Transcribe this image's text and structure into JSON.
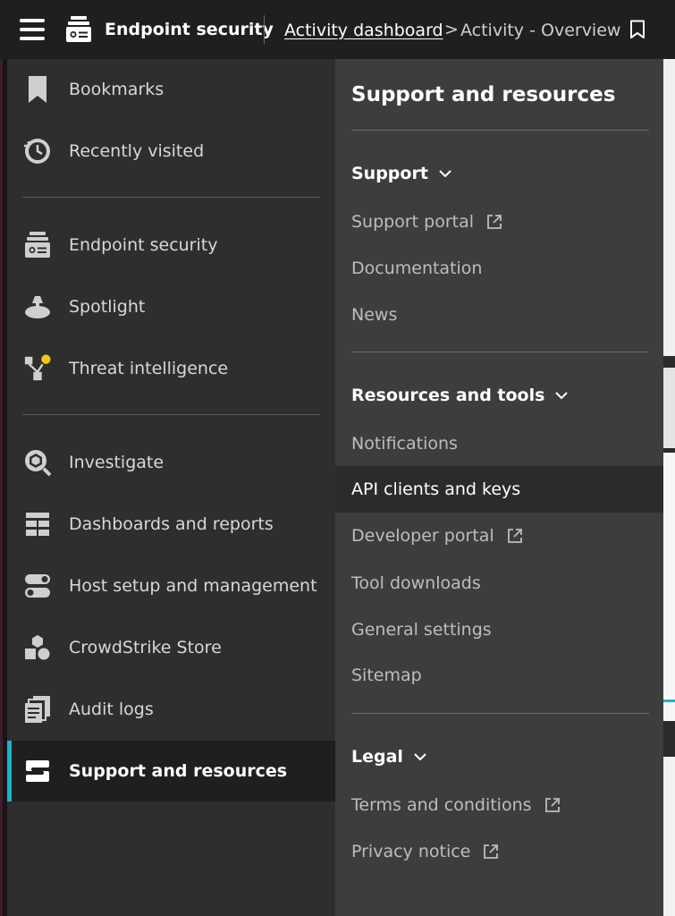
{
  "topbar": {
    "app_name": "Endpoint security",
    "breadcrumb_link": "Activity dashboard",
    "breadcrumb_sep": ">",
    "breadcrumb_current": "Activity - Overview",
    "icons": {
      "menu": "hamburger-icon",
      "app": "endpoint-security-icon",
      "bookmark": "bookmark-icon"
    }
  },
  "sidebar": {
    "items": [
      {
        "label": "Bookmarks",
        "icon": "bookmark-icon"
      },
      {
        "label": "Recently visited",
        "icon": "history-icon"
      },
      {
        "label": "Endpoint security",
        "icon": "endpoint-security-icon"
      },
      {
        "label": "Spotlight",
        "icon": "spotlight-icon"
      },
      {
        "label": "Threat intelligence",
        "icon": "threat-intelligence-icon"
      },
      {
        "label": "Investigate",
        "icon": "investigate-icon"
      },
      {
        "label": "Dashboards and reports",
        "icon": "dashboards-icon"
      },
      {
        "label": "Host setup and management",
        "icon": "host-setup-icon"
      },
      {
        "label": "CrowdStrike Store",
        "icon": "store-icon"
      },
      {
        "label": "Audit logs",
        "icon": "audit-logs-icon"
      },
      {
        "label": "Support and resources",
        "icon": "support-resources-icon"
      }
    ],
    "active_item": "Support and resources",
    "accent_color": "#19b3c9",
    "notification_dot_color": "#f5c518"
  },
  "panel": {
    "title": "Support and resources",
    "sections": [
      {
        "heading": "Support",
        "links": [
          {
            "label": "Support portal",
            "external": true
          },
          {
            "label": "Documentation",
            "external": false
          },
          {
            "label": "News",
            "external": false
          }
        ]
      },
      {
        "heading": "Resources and tools",
        "links": [
          {
            "label": "Notifications",
            "external": false
          },
          {
            "label": "API clients and keys",
            "external": false,
            "selected": true
          },
          {
            "label": "Developer portal",
            "external": true
          },
          {
            "label": "Tool downloads",
            "external": false
          },
          {
            "label": "General settings",
            "external": false
          },
          {
            "label": "Sitemap",
            "external": false
          }
        ]
      },
      {
        "heading": "Legal",
        "links": [
          {
            "label": "Terms and conditions",
            "external": true
          },
          {
            "label": "Privacy notice",
            "external": true
          }
        ]
      }
    ]
  }
}
